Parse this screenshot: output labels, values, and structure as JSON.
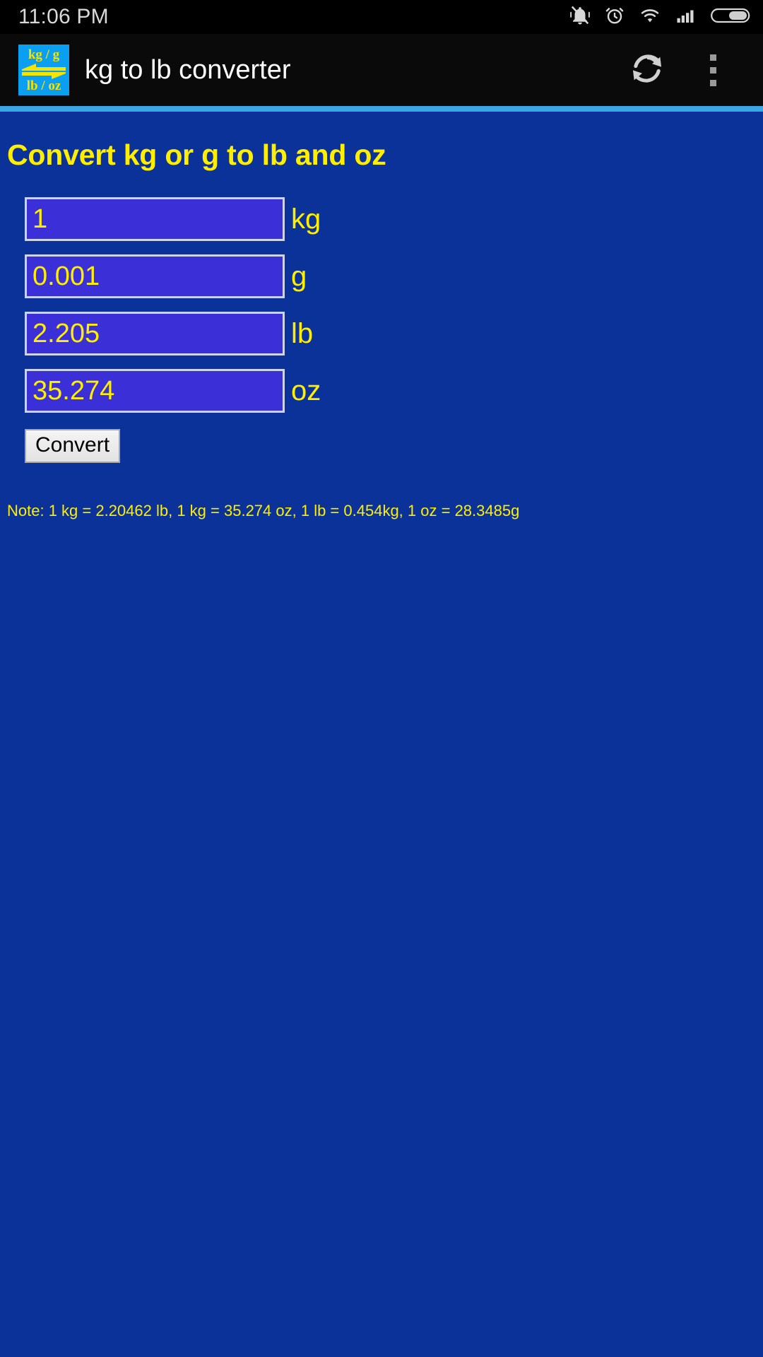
{
  "status_bar": {
    "time": "11:06 PM",
    "icons": [
      {
        "name": "notifications-muted-icon"
      },
      {
        "name": "alarm-clock-icon"
      },
      {
        "name": "wifi-icon"
      },
      {
        "name": "cellular-signal-icon"
      },
      {
        "name": "battery-icon"
      }
    ]
  },
  "app_bar": {
    "icon": {
      "name": "app-logo-icon",
      "top_text": "kg / g",
      "bottom_text": "lb / oz",
      "background_color": "#0a9ff0",
      "text_color": "#f5e400"
    },
    "title": "kg to lb converter",
    "refresh_label": "refresh-icon",
    "overflow_label": "more-options-icon"
  },
  "theme": {
    "page_background": "#0b3299",
    "divider_color": "#3aa7e4",
    "accent_text": "#ffee00",
    "field_background": "#3b30d8",
    "field_border": "#cfd4e4"
  },
  "main": {
    "heading": "Convert kg or g to lb and oz",
    "fields": [
      {
        "unit": "kg",
        "value": "1",
        "name": "kg-input"
      },
      {
        "unit": "g",
        "value": "0.001",
        "name": "g-input"
      },
      {
        "unit": "lb",
        "value": "2.205",
        "name": "lb-input"
      },
      {
        "unit": "oz",
        "value": "35.274",
        "name": "oz-input"
      }
    ],
    "convert_button": "Convert",
    "note": "Note: 1 kg = 2.20462 lb, 1 kg = 35.274 oz, 1 lb = 0.454kg, 1 oz = 28.3485g"
  }
}
